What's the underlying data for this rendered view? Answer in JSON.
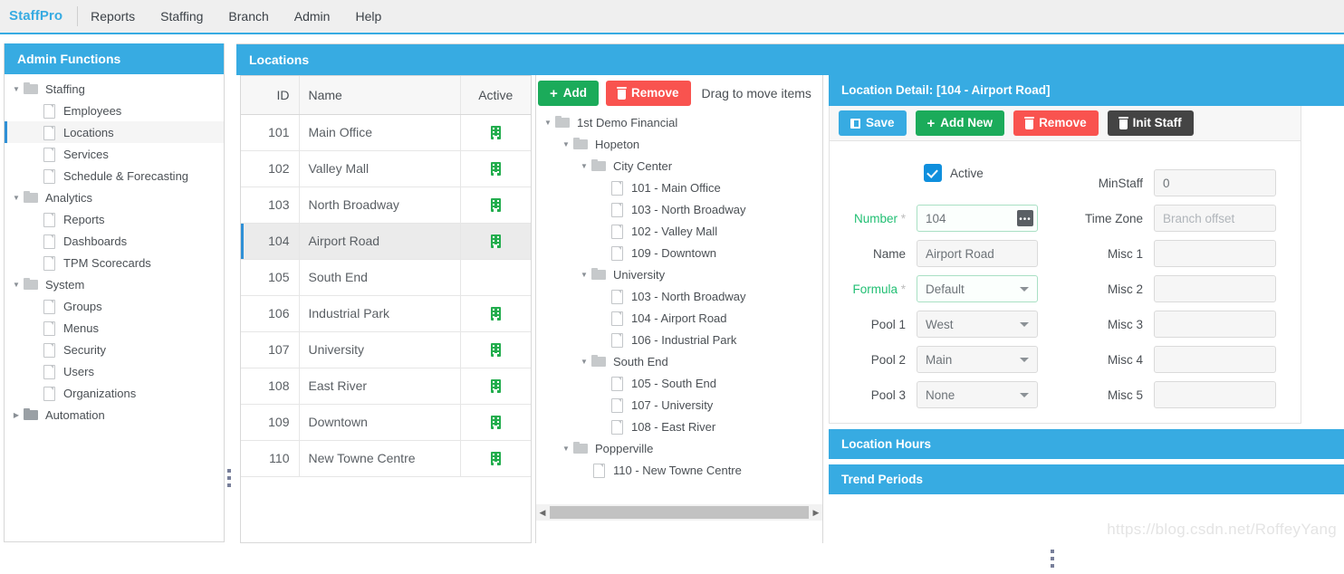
{
  "topnav": {
    "brand": "StaffPro",
    "items": [
      {
        "label": "Reports"
      },
      {
        "label": "Staffing"
      },
      {
        "label": "Branch"
      },
      {
        "label": "Admin"
      },
      {
        "label": "Help"
      }
    ]
  },
  "sidebar": {
    "title": "Admin Functions",
    "nodes": [
      {
        "label": "Staffing",
        "level": 1,
        "icon": "folder-icon",
        "arrow": "open",
        "selected": false
      },
      {
        "label": "Employees",
        "level": 2,
        "icon": "file-icon",
        "arrow": "none",
        "selected": false
      },
      {
        "label": "Locations",
        "level": 2,
        "icon": "file-icon",
        "arrow": "none",
        "selected": true
      },
      {
        "label": "Services",
        "level": 2,
        "icon": "file-icon",
        "arrow": "none",
        "selected": false
      },
      {
        "label": "Schedule & Forecasting",
        "level": 2,
        "icon": "file-icon",
        "arrow": "none",
        "selected": false
      },
      {
        "label": "Analytics",
        "level": 1,
        "icon": "folder-icon",
        "arrow": "open",
        "selected": false
      },
      {
        "label": "Reports",
        "level": 2,
        "icon": "file-icon",
        "arrow": "none",
        "selected": false
      },
      {
        "label": "Dashboards",
        "level": 2,
        "icon": "file-icon",
        "arrow": "none",
        "selected": false
      },
      {
        "label": "TPM Scorecards",
        "level": 2,
        "icon": "file-icon",
        "arrow": "none",
        "selected": false
      },
      {
        "label": "System",
        "level": 1,
        "icon": "folder-icon",
        "arrow": "open",
        "selected": false
      },
      {
        "label": "Groups",
        "level": 2,
        "icon": "file-icon",
        "arrow": "none",
        "selected": false
      },
      {
        "label": "Menus",
        "level": 2,
        "icon": "file-icon",
        "arrow": "none",
        "selected": false
      },
      {
        "label": "Security",
        "level": 2,
        "icon": "file-icon",
        "arrow": "none",
        "selected": false
      },
      {
        "label": "Users",
        "level": 2,
        "icon": "file-icon",
        "arrow": "none",
        "selected": false
      },
      {
        "label": "Organizations",
        "level": 2,
        "icon": "file-icon",
        "arrow": "none",
        "selected": false
      },
      {
        "label": "Automation",
        "level": 1,
        "icon": "folder-dark-icon",
        "arrow": "closed",
        "selected": false
      }
    ]
  },
  "locations": {
    "title": "Locations",
    "grid": {
      "columns": [
        "ID",
        "Name",
        "Active"
      ],
      "rows": [
        {
          "id": "101",
          "name": "Main Office",
          "active": true,
          "selected": false
        },
        {
          "id": "102",
          "name": "Valley Mall",
          "active": true,
          "selected": false
        },
        {
          "id": "103",
          "name": "North Broadway",
          "active": true,
          "selected": false
        },
        {
          "id": "104",
          "name": "Airport Road",
          "active": true,
          "selected": true
        },
        {
          "id": "105",
          "name": "South End",
          "active": false,
          "selected": false
        },
        {
          "id": "106",
          "name": "Industrial Park",
          "active": true,
          "selected": false
        },
        {
          "id": "107",
          "name": "University",
          "active": true,
          "selected": false
        },
        {
          "id": "108",
          "name": "East River",
          "active": true,
          "selected": false
        },
        {
          "id": "109",
          "name": "Downtown",
          "active": true,
          "selected": false
        },
        {
          "id": "110",
          "name": "New Towne Centre",
          "active": true,
          "selected": false
        }
      ]
    },
    "tree_toolbar": {
      "add_label": "Add",
      "remove_label": "Remove",
      "hint": "Drag to move items"
    },
    "tree": [
      {
        "label": "1st Demo Financial",
        "level": 1,
        "icon": "folder-icon",
        "arrow": "open"
      },
      {
        "label": "Hopeton",
        "level": 2,
        "icon": "folder-icon",
        "arrow": "open"
      },
      {
        "label": "City Center",
        "level": 3,
        "icon": "folder-icon",
        "arrow": "open"
      },
      {
        "label": "101 - Main Office",
        "level": 4,
        "icon": "file-icon",
        "arrow": "none"
      },
      {
        "label": "103 - North Broadway",
        "level": 4,
        "icon": "file-icon",
        "arrow": "none"
      },
      {
        "label": "102 - Valley Mall",
        "level": 4,
        "icon": "file-icon",
        "arrow": "none"
      },
      {
        "label": "109 - Downtown",
        "level": 4,
        "icon": "file-icon",
        "arrow": "none"
      },
      {
        "label": "University",
        "level": 3,
        "icon": "folder-icon",
        "arrow": "open"
      },
      {
        "label": "103 - North Broadway",
        "level": 4,
        "icon": "file-icon",
        "arrow": "none"
      },
      {
        "label": "104 - Airport Road",
        "level": 4,
        "icon": "file-icon",
        "arrow": "none"
      },
      {
        "label": "106 - Industrial Park",
        "level": 4,
        "icon": "file-icon",
        "arrow": "none"
      },
      {
        "label": "South End",
        "level": 3,
        "icon": "folder-icon",
        "arrow": "open"
      },
      {
        "label": "105 - South End",
        "level": 4,
        "icon": "file-icon",
        "arrow": "none"
      },
      {
        "label": "107 - University",
        "level": 4,
        "icon": "file-icon",
        "arrow": "none"
      },
      {
        "label": "108 - East River",
        "level": 4,
        "icon": "file-icon",
        "arrow": "none"
      },
      {
        "label": "Popperville",
        "level": 2,
        "icon": "folder-icon",
        "arrow": "open"
      },
      {
        "label": "110 - New Towne Centre",
        "level": 3,
        "icon": "file-icon",
        "arrow": "none"
      }
    ]
  },
  "detail": {
    "title": "Location Detail: [104 - Airport Road]",
    "toolbar": {
      "save_label": "Save",
      "add_new_label": "Add New",
      "remove_label": "Remove",
      "init_staff_label": "Init Staff"
    },
    "active": {
      "label": "Active",
      "checked": true
    },
    "fields_left": [
      {
        "label": "Number",
        "required": true,
        "value": "104",
        "type": "text",
        "valid": true,
        "ellipsis": true
      },
      {
        "label": "Name",
        "required": false,
        "value": "Airport Road",
        "type": "text",
        "valid": false,
        "ellipsis": false
      },
      {
        "label": "Formula",
        "required": true,
        "value": "Default",
        "type": "select",
        "valid": true,
        "ellipsis": false
      },
      {
        "label": "Pool 1",
        "required": false,
        "value": "West",
        "type": "select",
        "valid": false,
        "ellipsis": false
      },
      {
        "label": "Pool 2",
        "required": false,
        "value": "Main",
        "type": "select",
        "valid": false,
        "ellipsis": false
      },
      {
        "label": "Pool 3",
        "required": false,
        "value": "None",
        "type": "select",
        "valid": false,
        "ellipsis": false
      }
    ],
    "fields_right": [
      {
        "label": "MinStaff",
        "value": "0",
        "placeholder": "",
        "type": "text"
      },
      {
        "label": "Time Zone",
        "value": "",
        "placeholder": "Branch offset",
        "type": "text"
      },
      {
        "label": "Misc 1",
        "value": "",
        "placeholder": "",
        "type": "text"
      },
      {
        "label": "Misc 2",
        "value": "",
        "placeholder": "",
        "type": "text"
      },
      {
        "label": "Misc 3",
        "value": "",
        "placeholder": "",
        "type": "text"
      },
      {
        "label": "Misc 4",
        "value": "",
        "placeholder": "",
        "type": "text"
      },
      {
        "label": "Misc 5",
        "value": "",
        "placeholder": "",
        "type": "text"
      }
    ],
    "accordions": [
      {
        "label": "Location Hours"
      },
      {
        "label": "Trend Periods"
      }
    ]
  },
  "watermark": "https://blog.csdn.net/RoffeyYang",
  "colors": {
    "accent_blue": "#37abe2",
    "green": "#1bab5a",
    "red": "#f9534f",
    "dark": "#444444",
    "active_icon_green": "#23ad4e",
    "required_label_green": "#21bf73"
  }
}
